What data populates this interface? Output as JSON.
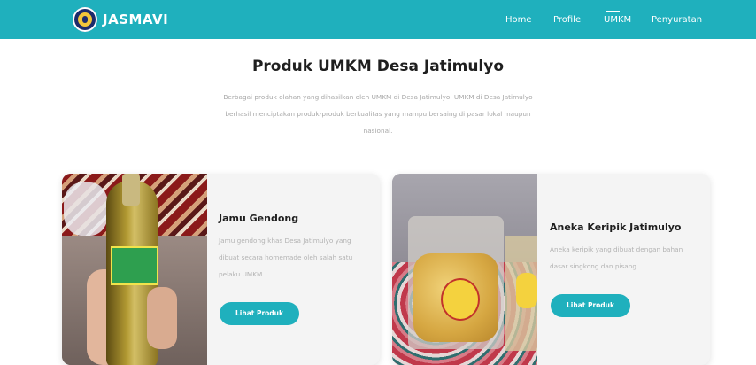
{
  "brand": {
    "name": "JASMAVI",
    "logo_icon": "jasmavi-logo-icon"
  },
  "nav": {
    "home": "Home",
    "profile": "Profile",
    "umkm": "UMKM",
    "penyuratan": "Penyuratan"
  },
  "page": {
    "title": "Produk UMKM Desa Jatimulyo",
    "intro": "Berbagai produk olahan yang dihasilkan oleh UMKM di Desa Jatimulyo. UMKM di Desa Jatimulyo berhasil menciptakan produk-produk berkualitas yang mampu bersaing di pasar lokal maupun nasional."
  },
  "products": [
    {
      "title": "Jamu Gendong",
      "description": "Jamu gendong khas Desa Jatimulyo yang dibuat secara homemade oleh salah satu pelaku UMKM.",
      "button": "Lihat Produk",
      "image_icon": "jamu-bottle-photo"
    },
    {
      "title": "Aneka Keripik Jatimulyo",
      "description": "Aneka keripik yang dibuat dengan bahan dasar singkong dan pisang.",
      "button": "Lihat Produk",
      "image_icon": "keripik-photo"
    }
  ],
  "colors": {
    "accent": "#1fb0bd",
    "title": "#1f1f1f",
    "muted": "#a7a7a7",
    "card": "#f4f4f4"
  }
}
